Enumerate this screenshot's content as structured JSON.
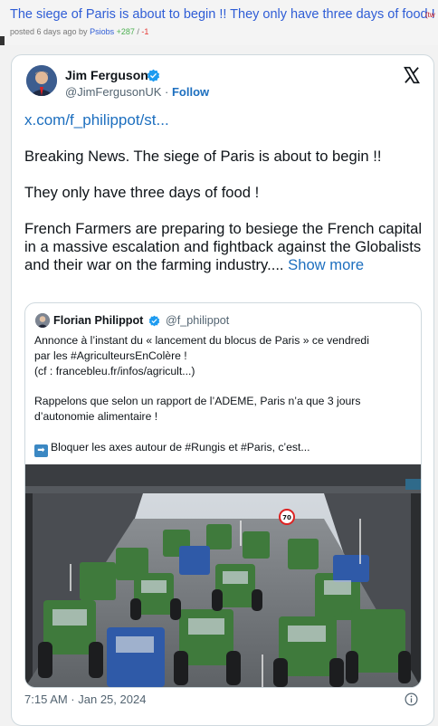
{
  "post": {
    "title": "The siege of Paris is about to begin !! They only have three days of food !",
    "tag": "(tw",
    "meta_prefix": "posted 6 days ago by ",
    "author": "Psiobs",
    "upvotes": "+287",
    "separator": " / ",
    "downvotes": "-1"
  },
  "tweet": {
    "display_name": "Jim Ferguson",
    "handle": "@JimFergusonUK",
    "dot": " · ",
    "follow_label": "Follow",
    "link": "x.com/f_philippot/st...",
    "paragraphs": [
      "Breaking News. The siege of Paris is about to begin !!",
      "They only have three days of food !",
      "French Farmers are preparing to besiege the French capital in a massive escalation and fightback against the Globalists and their war on the farming industry.... "
    ],
    "show_more": "Show more",
    "timestamp": "7:15 AM · Jan 25, 2024",
    "icons": {
      "logo": "x-logo-icon",
      "verified": "verified-badge-icon",
      "info": "info-icon"
    }
  },
  "quote": {
    "display_name": "Florian Philippot",
    "handle": "@f_philippot",
    "lines": [
      "Annonce à l’instant du « lancement du blocus de Paris » ce vendredi",
      "par les #AgriculteursEnColère !",
      "(cf : francebleu.fr/infos/agricult...)",
      "Rappelons que selon un rapport de l’ADEME, Paris n’a que 3 jours",
      "d’autonomie alimentaire !",
      "Bloquer les axes autour de #Rungis et #Paris, c’est..."
    ],
    "arrow_emoji": "➡",
    "photo_sign": "70"
  },
  "colors": {
    "link": "#1d6fbf",
    "title": "#2f5dd6",
    "border": "#cfd9de",
    "verified": "#1d9bf0"
  }
}
